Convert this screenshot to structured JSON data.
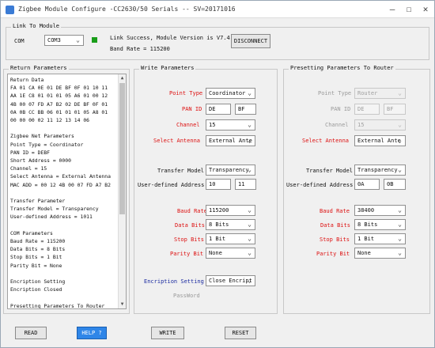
{
  "window": {
    "title": "Zigbee Module Configure  -CC2630/50 Serials --  SV=20171016",
    "minimize": "—",
    "maximize": "☐",
    "close": "✕"
  },
  "link": {
    "group_label": "Link To Module",
    "com_label": "COM",
    "com_value": "COM3",
    "status_line": "Link Success, Module Version is V7.4",
    "baud_line": "Band Rate = 115200",
    "disconnect_label": "DISCONNECT"
  },
  "return_params": {
    "group_label": "Return Parameters",
    "lines": [
      "Return Data",
      "FA 01 CA 0E 01 DE BF 0F 01 10 11",
      "AA 1E C8 01 01 01 05 A6 01 00 12",
      "4B 00 07 FD A7 B2 02 DE BF 0F 01",
      "0A 0B CC BB 06 01 01 01 05 A8 01",
      "00 00 00 02 11 12 13 14 06",
      "",
      "      Zigbee Net Parameters",
      "Point Type = Coordinator",
      "PAN ID = DEBF",
      "Short Address = 0000",
      "Channel = 15",
      "Select Antenna = External Antenna",
      "MAC ADD = 00 12 4B 00 07 FD A7 B2",
      "",
      "       Transfer Parameter",
      "Transfer Model = Transparency",
      "User-defined Address = 1011",
      "",
      "        COM Parameters",
      "Baud Rate = 115200",
      "Data Bits = 8 Bits",
      "Stop Bits = 1 Bit",
      "Parity Bit = None",
      "",
      "        Encription Setting",
      "Encription Closed",
      "",
      "  Presetting Parameters To Router"
    ]
  },
  "write_params": {
    "group_label": "Write Parameters",
    "point_type_label": "Point Type",
    "point_type_value": "Coordinator",
    "pan_id_label": "PAN ID",
    "pan_id_1": "DE",
    "pan_id_2": "BF",
    "channel_label": "Channel",
    "channel_value": "15",
    "antenna_label": "Select Antenna",
    "antenna_value": "External Ante",
    "transfer_label": "Transfer Model",
    "transfer_value": "Transparency",
    "address_label": "User-defined Address",
    "address_1": "10",
    "address_2": "11",
    "baud_label": "Baud Rate",
    "baud_value": "115200",
    "data_bits_label": "Data Bits",
    "data_bits_value": "8 Bits",
    "stop_bits_label": "Stop Bits",
    "stop_bits_value": "1 Bit",
    "parity_label": "Parity Bit",
    "parity_value": "None",
    "encrypt_label": "Encription Setting",
    "encrypt_value": "Close Encript",
    "password_label": "PassWord"
  },
  "router_params": {
    "group_label": "Presetting Parameters To Router",
    "point_type_label": "Point Type",
    "point_type_value": "Router",
    "pan_id_label": "PAN ID",
    "pan_id_1": "DE",
    "pan_id_2": "BF",
    "channel_label": "Channel",
    "channel_value": "15",
    "antenna_label": "Select Antenna",
    "antenna_value": "External Ante",
    "transfer_label": "Transfer Model",
    "transfer_value": "Transparency",
    "address_label": "User-defined Address",
    "address_1": "0A",
    "address_2": "0B",
    "baud_label": "Baud Rate",
    "baud_value": "38400",
    "data_bits_label": "Data Bits",
    "data_bits_value": "8 Bits",
    "stop_bits_label": "Stop Bits",
    "stop_bits_value": "1 Bit",
    "parity_label": "Parity Bit",
    "parity_value": "None"
  },
  "buttons": {
    "read": "READ",
    "help": "HELP ?",
    "write": "WRITE",
    "reset": "RESET"
  },
  "icons": {
    "dropdown": "⌄",
    "scroll_up": "▲",
    "scroll_down": "▼"
  },
  "colors": {
    "label_red": "#d11111",
    "label_blue": "#1a2aa0",
    "status_green": "#1a9e1a",
    "active_button": "#2f86e8"
  }
}
